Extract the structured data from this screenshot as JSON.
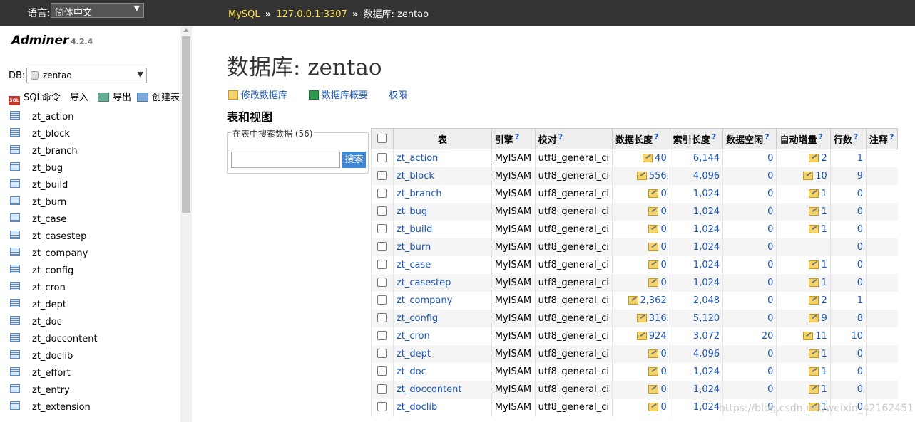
{
  "topbar": {
    "language_label": "语言:",
    "language_value": "简体中文",
    "breadcrumb": {
      "server_type": "MySQL",
      "separator": "»",
      "server": "127.0.0.1:3307",
      "current": "数据库: zentao"
    }
  },
  "sidebar": {
    "app_name": "Adminer",
    "app_version": "4.2.4",
    "db_label": "DB:",
    "db_value": "zentao",
    "tools": {
      "sql": "SQL命令",
      "import": "导入",
      "export": "导出",
      "create": "创建表"
    },
    "tables": [
      "zt_action",
      "zt_block",
      "zt_branch",
      "zt_bug",
      "zt_build",
      "zt_burn",
      "zt_case",
      "zt_casestep",
      "zt_company",
      "zt_config",
      "zt_cron",
      "zt_dept",
      "zt_doc",
      "zt_doccontent",
      "zt_doclib",
      "zt_effort",
      "zt_entry",
      "zt_extension"
    ]
  },
  "main": {
    "title": "数据库: zentao",
    "actions": {
      "alter_db": "修改数据库",
      "db_schema": "数据库概要",
      "privileges": "权限"
    },
    "section_title": "表和视图",
    "search": {
      "legend": "在表中搜索数据 (56)",
      "value": "",
      "button": "搜索"
    },
    "table": {
      "headers": {
        "table": "表",
        "engine": "引擎",
        "collation": "校对",
        "data_length": "数据长度",
        "index_length": "索引长度",
        "data_free": "数据空闲",
        "auto_increment": "自动增量",
        "rows": "行数",
        "comment": "注释"
      },
      "help_mark": "?",
      "rows": [
        {
          "name": "zt_action",
          "engine": "MyISAM",
          "collation": "utf8_general_ci",
          "data_length": "40",
          "index_length": "6,144",
          "data_free": "0",
          "auto_increment": "2",
          "rows": "1"
        },
        {
          "name": "zt_block",
          "engine": "MyISAM",
          "collation": "utf8_general_ci",
          "data_length": "556",
          "index_length": "4,096",
          "data_free": "0",
          "auto_increment": "10",
          "rows": "9"
        },
        {
          "name": "zt_branch",
          "engine": "MyISAM",
          "collation": "utf8_general_ci",
          "data_length": "0",
          "index_length": "1,024",
          "data_free": "0",
          "auto_increment": "1",
          "rows": "0"
        },
        {
          "name": "zt_bug",
          "engine": "MyISAM",
          "collation": "utf8_general_ci",
          "data_length": "0",
          "index_length": "1,024",
          "data_free": "0",
          "auto_increment": "1",
          "rows": "0"
        },
        {
          "name": "zt_build",
          "engine": "MyISAM",
          "collation": "utf8_general_ci",
          "data_length": "0",
          "index_length": "1,024",
          "data_free": "0",
          "auto_increment": "1",
          "rows": "0"
        },
        {
          "name": "zt_burn",
          "engine": "MyISAM",
          "collation": "utf8_general_ci",
          "data_length": "0",
          "index_length": "1,024",
          "data_free": "0",
          "auto_increment": "",
          "rows": "0"
        },
        {
          "name": "zt_case",
          "engine": "MyISAM",
          "collation": "utf8_general_ci",
          "data_length": "0",
          "index_length": "1,024",
          "data_free": "0",
          "auto_increment": "1",
          "rows": "0"
        },
        {
          "name": "zt_casestep",
          "engine": "MyISAM",
          "collation": "utf8_general_ci",
          "data_length": "0",
          "index_length": "1,024",
          "data_free": "0",
          "auto_increment": "1",
          "rows": "0"
        },
        {
          "name": "zt_company",
          "engine": "MyISAM",
          "collation": "utf8_general_ci",
          "data_length": "2,362",
          "index_length": "2,048",
          "data_free": "0",
          "auto_increment": "2",
          "rows": "1"
        },
        {
          "name": "zt_config",
          "engine": "MyISAM",
          "collation": "utf8_general_ci",
          "data_length": "316",
          "index_length": "5,120",
          "data_free": "0",
          "auto_increment": "9",
          "rows": "8"
        },
        {
          "name": "zt_cron",
          "engine": "MyISAM",
          "collation": "utf8_general_ci",
          "data_length": "924",
          "index_length": "3,072",
          "data_free": "20",
          "auto_increment": "11",
          "rows": "10"
        },
        {
          "name": "zt_dept",
          "engine": "MyISAM",
          "collation": "utf8_general_ci",
          "data_length": "0",
          "index_length": "4,096",
          "data_free": "0",
          "auto_increment": "1",
          "rows": "0"
        },
        {
          "name": "zt_doc",
          "engine": "MyISAM",
          "collation": "utf8_general_ci",
          "data_length": "0",
          "index_length": "1,024",
          "data_free": "0",
          "auto_increment": "1",
          "rows": "0"
        },
        {
          "name": "zt_doccontent",
          "engine": "MyISAM",
          "collation": "utf8_general_ci",
          "data_length": "0",
          "index_length": "1,024",
          "data_free": "0",
          "auto_increment": "1",
          "rows": "0"
        },
        {
          "name": "zt_doclib",
          "engine": "MyISAM",
          "collation": "utf8_general_ci",
          "data_length": "0",
          "index_length": "1,024",
          "data_free": "0",
          "auto_increment": "1",
          "rows": "0"
        }
      ]
    }
  },
  "watermark": "https://blog.csdn.net/weixin_42162451"
}
